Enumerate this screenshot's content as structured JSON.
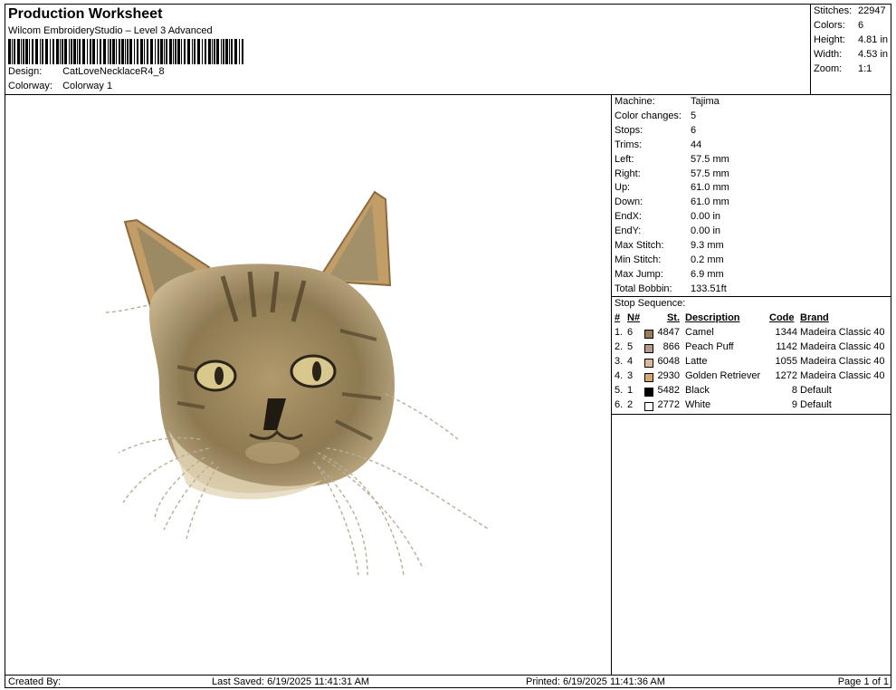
{
  "header": {
    "title": "Production Worksheet",
    "subtitle": "Wilcom EmbroideryStudio – Level 3 Advanced",
    "design_label": "Design:",
    "design_value": "CatLoveNecklaceR4_8",
    "colorway_label": "Colorway:",
    "colorway_value": "Colorway 1"
  },
  "summary": [
    {
      "k": "Stitches:",
      "v": "22947"
    },
    {
      "k": "Colors:",
      "v": "6"
    },
    {
      "k": "Height:",
      "v": "4.81 in"
    },
    {
      "k": "Width:",
      "v": "4.53 in"
    },
    {
      "k": "Zoom:",
      "v": "1:1"
    }
  ],
  "machine": [
    {
      "k": "Machine:",
      "v": "Tajima"
    },
    {
      "k": "Color changes:",
      "v": "5"
    },
    {
      "k": "Stops:",
      "v": "6"
    },
    {
      "k": "Trims:",
      "v": "44"
    },
    {
      "k": "Left:",
      "v": "57.5 mm"
    },
    {
      "k": "Right:",
      "v": "57.5 mm"
    },
    {
      "k": "Up:",
      "v": "61.0 mm"
    },
    {
      "k": "Down:",
      "v": "61.0 mm"
    },
    {
      "k": "EndX:",
      "v": "0.00 in"
    },
    {
      "k": "EndY:",
      "v": "0.00 in"
    },
    {
      "k": "Max Stitch:",
      "v": "9.3 mm"
    },
    {
      "k": "Min Stitch:",
      "v": "0.2 mm"
    },
    {
      "k": "Max Jump:",
      "v": "6.9 mm"
    },
    {
      "k": "Total Bobbin:",
      "v": "133.51ft"
    }
  ],
  "stop_sequence": {
    "label": "Stop Sequence:",
    "headers": {
      "num": "#",
      "n": "N#",
      "st": "St.",
      "desc": "Description",
      "code": "Code",
      "brand": "Brand"
    },
    "rows": [
      {
        "num": "1.",
        "n": "6",
        "st": "4847",
        "desc": "Camel",
        "code": "1344",
        "brand": "Madeira Classic 40",
        "color": "#9c7a55"
      },
      {
        "num": "2.",
        "n": "5",
        "st": "866",
        "desc": "Peach Puff",
        "code": "1142",
        "brand": "Madeira Classic 40",
        "color": "#b8998a"
      },
      {
        "num": "3.",
        "n": "4",
        "st": "6048",
        "desc": "Latte",
        "code": "1055",
        "brand": "Madeira Classic 40",
        "color": "#d9b998"
      },
      {
        "num": "4.",
        "n": "3",
        "st": "2930",
        "desc": "Golden Retriever",
        "code": "1272",
        "brand": "Madeira Classic 40",
        "color": "#d8a66e"
      },
      {
        "num": "5.",
        "n": "1",
        "st": "5482",
        "desc": "Black",
        "code": "8",
        "brand": "Default",
        "color": "#000000"
      },
      {
        "num": "6.",
        "n": "2",
        "st": "2772",
        "desc": "White",
        "code": "9",
        "brand": "Default",
        "color": "#ffffff"
      }
    ]
  },
  "footer": {
    "created": "Created By:",
    "saved": "Last Saved: 6/19/2025 11:41:31 AM",
    "printed": "Printed: 6/19/2025 11:41:36 AM",
    "page": "Page 1 of 1"
  }
}
